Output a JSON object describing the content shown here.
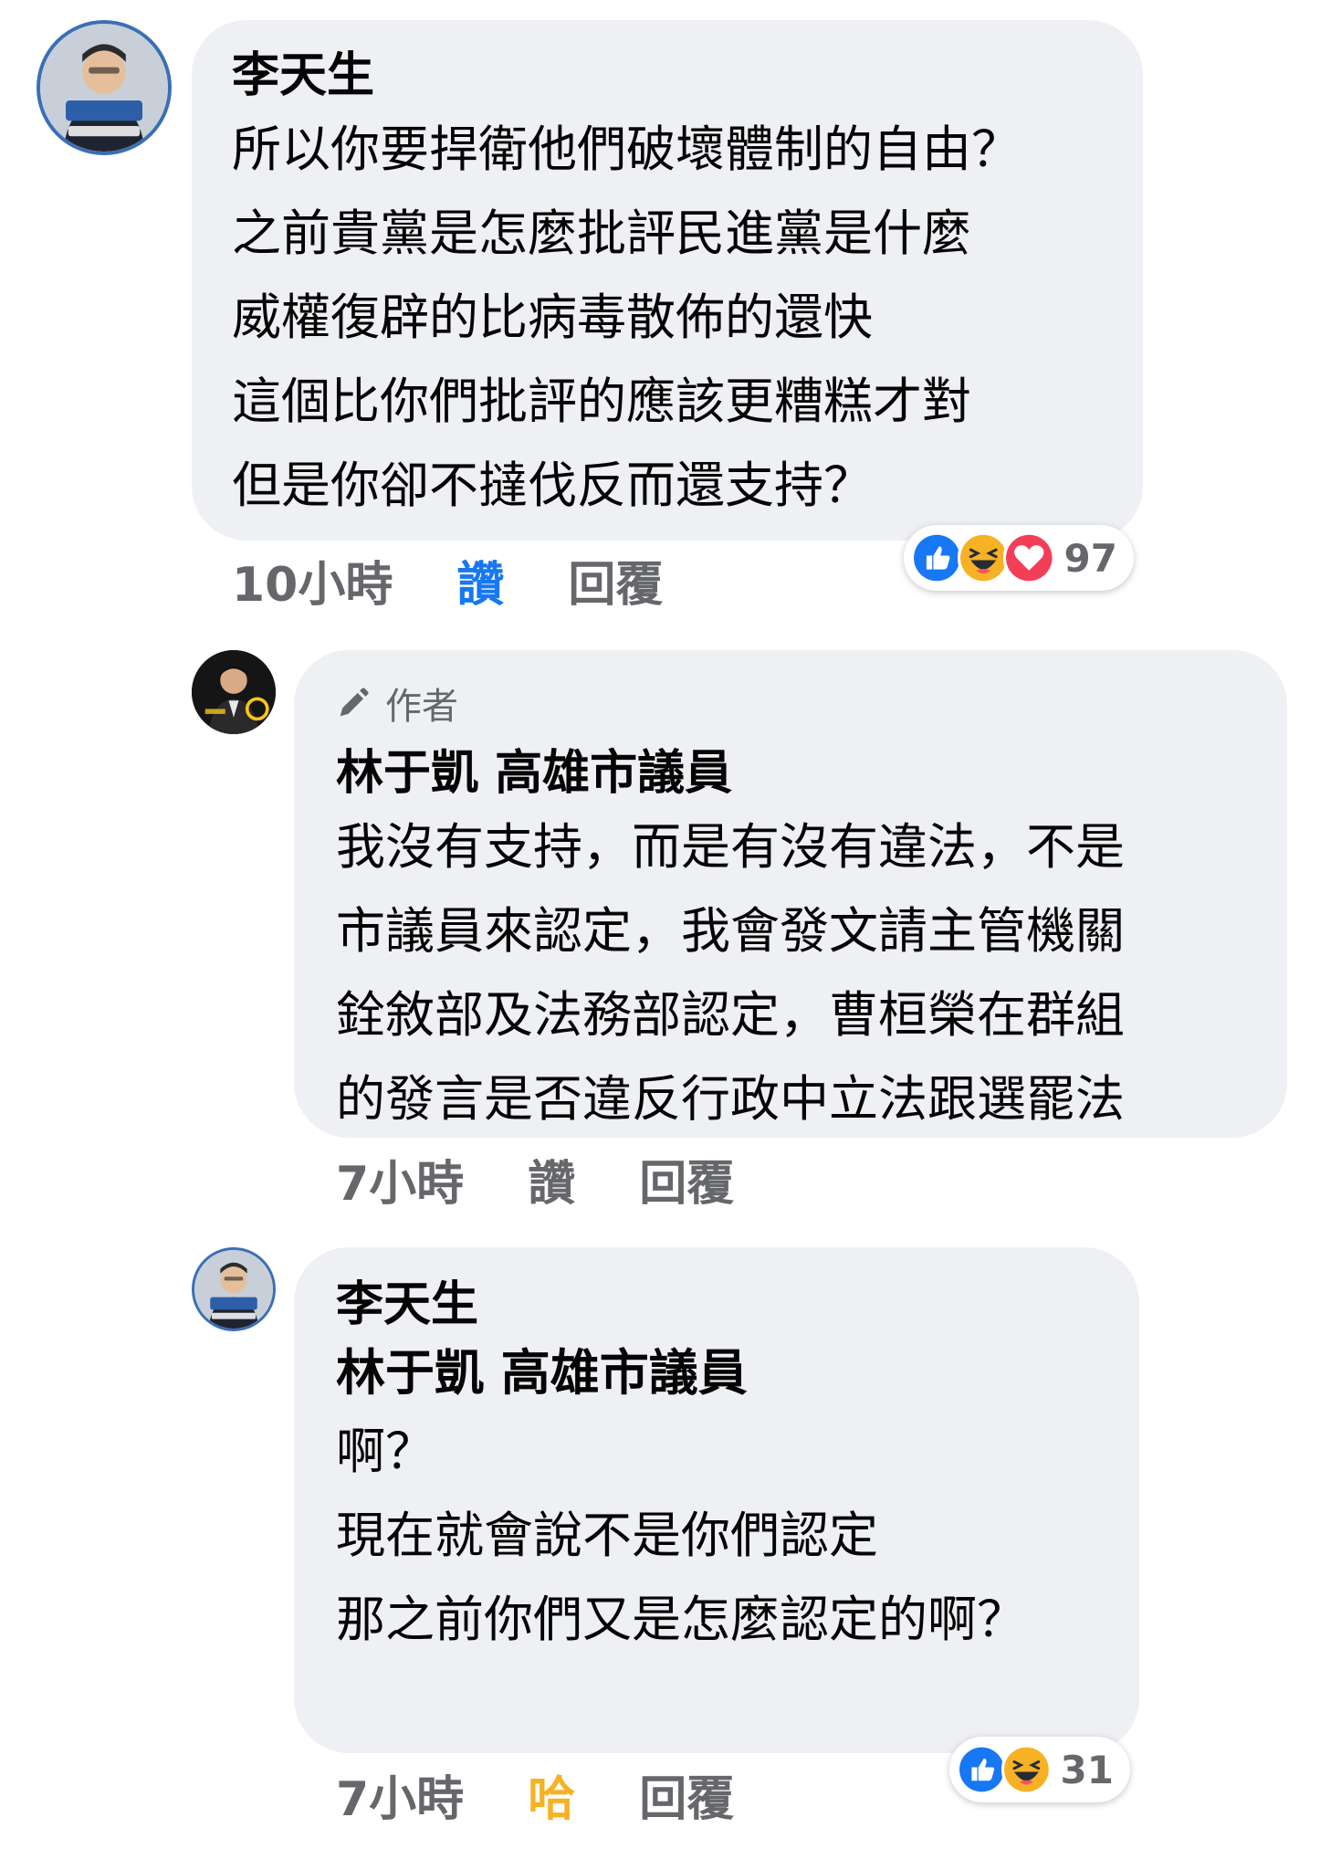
{
  "comments": [
    {
      "author": "李天生",
      "lines": [
        "所以你要捍衛他們破壞體制的自由？",
        "之前貴黨是怎麼批評民進黨是什麼",
        "威權復辟的比病毒散佈的還快",
        "這個比你們批評的應該更糟糕才對",
        "但是你卻不撻伐反而還支持？"
      ],
      "time": "10小時",
      "like_label": "讚",
      "reply_label": "回覆",
      "reaction_count": "97",
      "reactions": [
        "like-icon",
        "haha-icon",
        "love-icon"
      ]
    },
    {
      "author_badge": "作者",
      "author": "林于凱 高雄市議員",
      "lines": [
        "我沒有支持，而是有沒有違法，不是",
        "市議員來認定，我會發文請主管機關",
        "銓敘部及法務部認定，曹桓榮在群組",
        "的發言是否違反行政中立法跟選罷法"
      ],
      "time": "7小時",
      "like_label": "讚",
      "reply_label": "回覆"
    },
    {
      "author": "李天生",
      "mention": "林于凱 高雄市議員",
      "lines": [
        "啊？",
        "現在就會說不是你們認定",
        "那之前你們又是怎麼認定的啊？"
      ],
      "time": "7小時",
      "like_label": "哈",
      "reply_label": "回覆",
      "reaction_count": "31",
      "reactions": [
        "like-icon",
        "haha-icon"
      ]
    }
  ],
  "colors": {
    "bubble": "#eef0f3",
    "meta_text": "#65676b",
    "like_active": "#1877f2",
    "haha_active": "#f7b125",
    "love": "#f33e58"
  }
}
